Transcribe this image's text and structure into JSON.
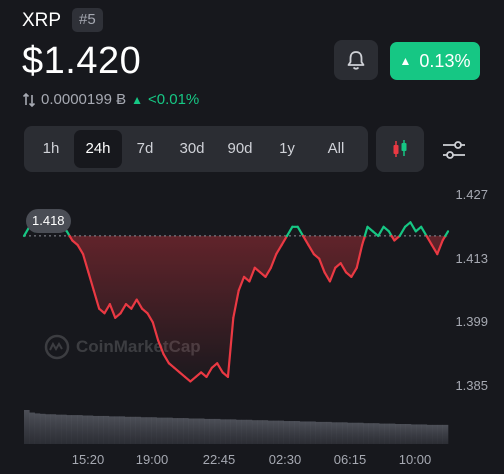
{
  "header": {
    "coin_name": "XRP",
    "rank": "#5",
    "price": "$1.420",
    "btc_value": "0.0000199 Ƀ",
    "btc_change": "<0.01%",
    "change_pct": "0.13%"
  },
  "range_tabs": [
    "1h",
    "24h",
    "7d",
    "30d",
    "90d",
    "1y",
    "All"
  ],
  "active_range": "24h",
  "icons": {
    "bell": "bell-icon",
    "candles": "candlestick-icon",
    "settings": "sliders-icon",
    "swap": "swap-arrows-icon",
    "watermark": "coinmarketcap-logo"
  },
  "watermark_text": "CoinMarketCap",
  "colors": {
    "up": "#16c784",
    "down": "#ea3943",
    "background": "#17181d",
    "panel": "#2b2d33"
  },
  "chart_data": {
    "type": "line",
    "ylim": [
      1.38,
      1.43
    ],
    "y_ticks": [
      "1.427",
      "1.413",
      "1.399",
      "1.385"
    ],
    "x_ticks": [
      "15:20",
      "19:00",
      "22:45",
      "02:30",
      "06:15",
      "10:00"
    ],
    "reference_value": 1.418,
    "tooltip_label": "1.418",
    "series": [
      {
        "values": [
          1.418,
          1.42,
          1.419,
          1.421,
          1.42,
          1.422,
          1.421,
          1.42,
          1.419,
          1.417,
          1.416,
          1.414,
          1.41,
          1.406,
          1.402,
          1.401,
          1.403,
          1.4,
          1.401,
          1.403,
          1.402,
          1.404,
          1.402,
          1.401,
          1.399,
          1.395,
          1.392,
          1.39,
          1.389,
          1.388,
          1.387,
          1.386,
          1.387,
          1.388,
          1.387,
          1.389,
          1.39,
          1.388,
          1.387,
          1.4,
          1.406,
          1.409,
          1.408,
          1.411,
          1.41,
          1.409,
          1.411,
          1.414,
          1.416,
          1.418,
          1.42,
          1.42,
          1.418,
          1.416,
          1.414,
          1.413,
          1.41,
          1.408,
          1.411,
          1.412,
          1.41,
          1.409,
          1.411,
          1.416,
          1.42,
          1.419,
          1.418,
          1.42,
          1.419,
          1.417,
          1.418,
          1.42,
          1.421,
          1.419,
          1.42,
          1.418,
          1.416,
          1.414,
          1.417,
          1.419
        ],
        "volume": [
          0.8,
          0.74,
          0.72,
          0.71,
          0.7,
          0.7,
          0.69,
          0.69,
          0.68,
          0.68,
          0.68,
          0.67,
          0.67,
          0.66,
          0.66,
          0.66,
          0.65,
          0.65,
          0.65,
          0.64,
          0.64,
          0.64,
          0.63,
          0.63,
          0.63,
          0.62,
          0.62,
          0.62,
          0.61,
          0.61,
          0.61,
          0.6,
          0.6,
          0.6,
          0.59,
          0.59,
          0.59,
          0.58,
          0.58,
          0.58,
          0.57,
          0.57,
          0.57,
          0.56,
          0.56,
          0.56,
          0.55,
          0.55,
          0.55,
          0.54,
          0.54,
          0.54,
          0.53,
          0.53,
          0.53,
          0.52,
          0.52,
          0.52,
          0.51,
          0.51,
          0.51,
          0.5,
          0.5,
          0.5,
          0.49,
          0.49,
          0.49,
          0.48,
          0.48,
          0.48,
          0.47,
          0.47,
          0.47,
          0.46,
          0.46,
          0.46,
          0.45,
          0.45,
          0.45,
          0.45
        ]
      }
    ]
  }
}
